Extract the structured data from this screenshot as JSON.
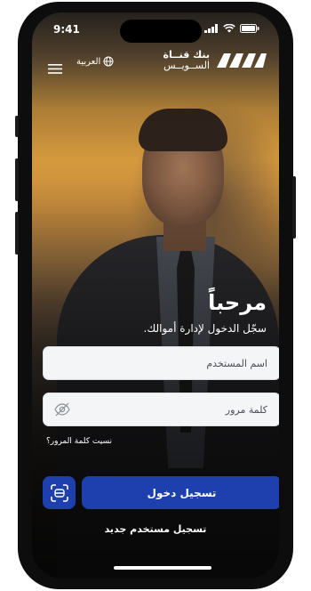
{
  "status_bar": {
    "time": "9:41"
  },
  "header": {
    "language_label": "العربية",
    "logo_line1": "بنك قنــاة",
    "logo_line2": "الســويــس",
    "icons": {
      "menu": "menu-icon",
      "language": "globe-icon",
      "logo": "bank-logo-mark"
    }
  },
  "login": {
    "welcome": "مرحباً",
    "subtitle": "سجّل الدخول لإدارة أموالك.",
    "username_placeholder": "اسم المستخدم",
    "password_placeholder": "كلمة مرور",
    "forgot_password": "نسيت كلمة المرور؟",
    "login_button": "تسجيل دخول",
    "register_link": "تسجيل مستخدم جديد",
    "icons": {
      "password_toggle": "eye-slash-icon",
      "biometric": "face-id-icon"
    }
  },
  "colors": {
    "primary": "#1e3fae",
    "field_bg": "#f4f5f7",
    "text_light": "#ffffff"
  }
}
